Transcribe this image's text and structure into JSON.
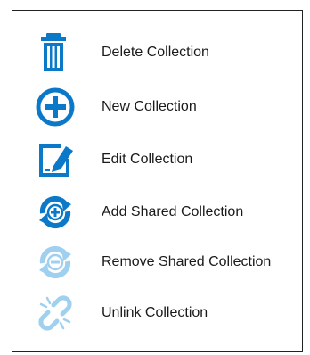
{
  "menu": {
    "items": [
      {
        "label": "Delete Collection",
        "icon": "trash-icon",
        "enabled": true
      },
      {
        "label": "New Collection",
        "icon": "plus-circle-icon",
        "enabled": true
      },
      {
        "label": "Edit Collection",
        "icon": "edit-icon",
        "enabled": true
      },
      {
        "label": "Add Shared Collection",
        "icon": "add-shared-icon",
        "enabled": true
      },
      {
        "label": "Remove Shared Collection",
        "icon": "remove-shared-icon",
        "enabled": false
      },
      {
        "label": "Unlink Collection",
        "icon": "unlink-icon",
        "enabled": false
      }
    ]
  },
  "colors": {
    "accent": "#0b78c8",
    "disabled_accent": "#9fd0ef",
    "text": "#1a1a1a",
    "border": "#222222"
  }
}
